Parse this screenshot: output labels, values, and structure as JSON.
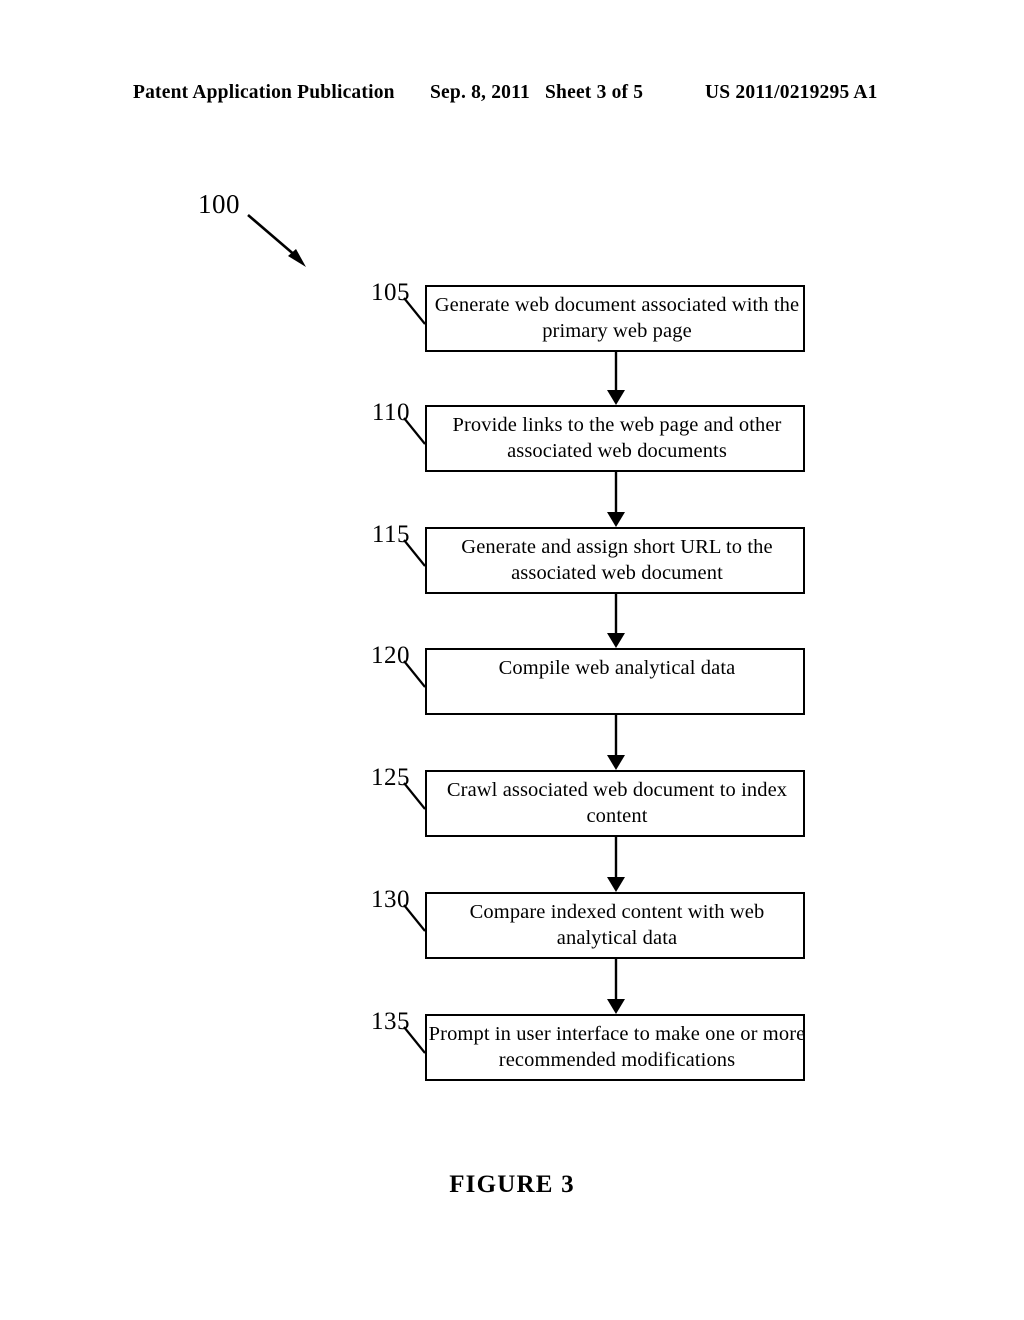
{
  "header": {
    "publication": "Patent Application Publication",
    "date": "Sep. 8, 2011",
    "sheet": "Sheet 3 of 5",
    "patent_number": "US 2011/0219295 A1"
  },
  "figure": {
    "system_label": "100",
    "caption": "FIGURE 3"
  },
  "flow": {
    "steps": [
      {
        "ref": "105",
        "text": "Generate web document associated with the primary web page"
      },
      {
        "ref": "110",
        "text": "Provide links to the web page and other associated web documents"
      },
      {
        "ref": "115",
        "text": "Generate and assign short URL to the associated web document"
      },
      {
        "ref": "120",
        "text": "Compile web analytical data"
      },
      {
        "ref": "125",
        "text": "Crawl associated web document to index content"
      },
      {
        "ref": "130",
        "text": "Compare indexed content with web analytical data"
      },
      {
        "ref": "135",
        "text": "Prompt in user interface to make one or more recommended modifications"
      }
    ]
  },
  "colors": {
    "ink": "#000000",
    "paper": "#ffffff"
  }
}
